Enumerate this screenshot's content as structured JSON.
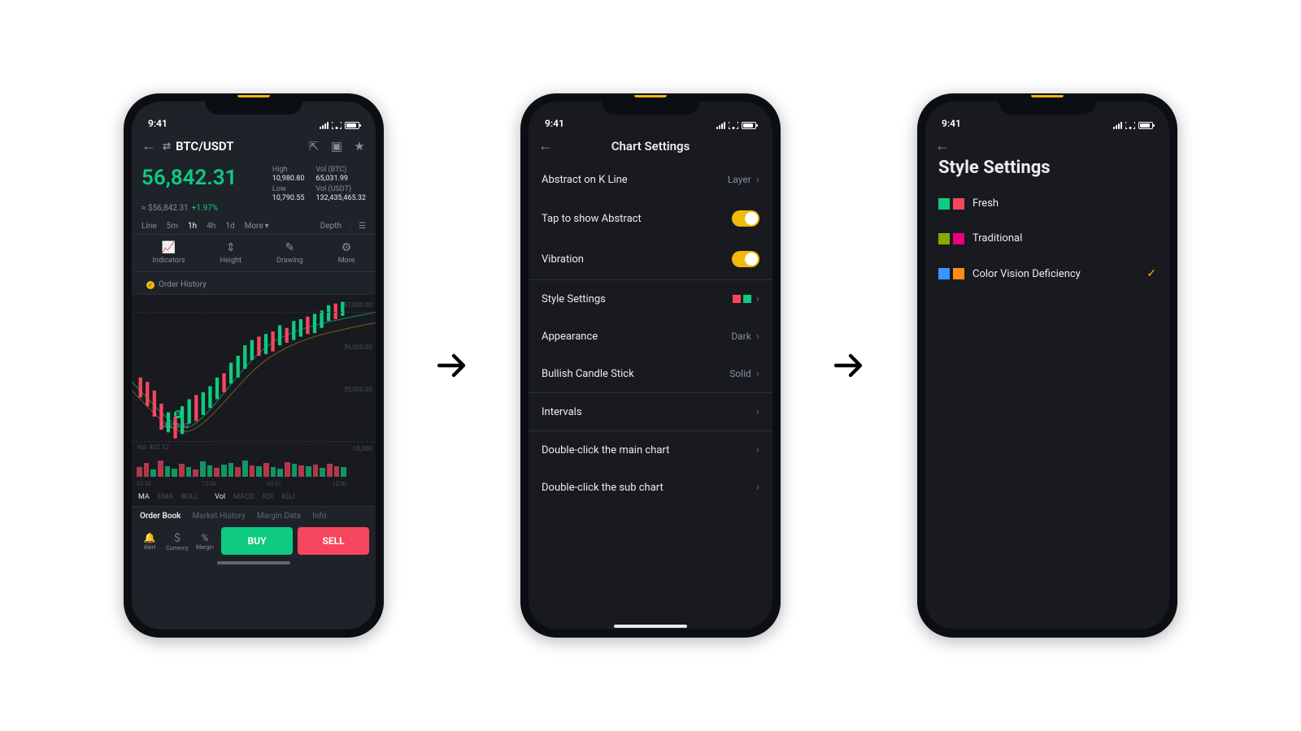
{
  "status_time": "9:41",
  "screen1": {
    "pair": "BTC/USDT",
    "price": "56,842.31",
    "approx": "≈ $56,842.31",
    "change_pct": "+1.97%",
    "stat_high_label": "High",
    "stat_high_val": "10,980.80",
    "stat_low_label": "Low",
    "stat_low_val": "10,790.55",
    "stat_vol_btc_label": "Vol (BTC)",
    "stat_vol_btc_val": "65,031.99",
    "stat_vol_usdt_label": "Vol (USDT)",
    "stat_vol_usdt_val": "132,435,465.32",
    "tf_line": "Line",
    "tf_5m": "5m",
    "tf_1h": "1h",
    "tf_4h": "4h",
    "tf_1d": "1d",
    "tf_more": "More",
    "tf_depth": "Depth",
    "tool_indicators": "Indicators",
    "tool_height": "Height",
    "tool_drawing": "Drawing",
    "tool_more": "More",
    "order_history": "Order History",
    "y1": "57,000.00",
    "y2": "56,000.00",
    "y3": "55,000.00",
    "y4": "10,000",
    "chart_annot": "54,123.32",
    "vol_label": "Vol: 402.12",
    "x_labels": [
      "03-30",
      "12:00",
      "03-31",
      "12:00"
    ],
    "ind_ma": "MA",
    "ind_ema": "EMA",
    "ind_boll": "BOLL",
    "ind_vol": "Vol",
    "ind_macd": "MACD",
    "ind_rsi": "RSI",
    "ind_kdj": "KDJ",
    "tab_orderbook": "Order Book",
    "tab_market": "Market History",
    "tab_margin": "Margin Data",
    "tab_info": "Info",
    "mini_alert": "Alert",
    "mini_currency": "Currency",
    "mini_margin": "Margin",
    "buy": "BUY",
    "sell": "SELL"
  },
  "screen2": {
    "title": "Chart Settings",
    "row_abstract": "Abstract on K Line",
    "row_abstract_val": "Layer",
    "row_tap": "Tap to show Abstract",
    "row_vibration": "Vibration",
    "row_style": "Style Settings",
    "row_appearance": "Appearance",
    "row_appearance_val": "Dark",
    "row_candle": "Bullish Candle Stick",
    "row_candle_val": "Solid",
    "row_intervals": "Intervals",
    "row_dbl_main": "Double-click the main chart",
    "row_dbl_sub": "Double-click the sub chart",
    "style_swatch_red": "#f6465d",
    "style_swatch_green": "#0ecb81"
  },
  "screen3": {
    "title": "Style Settings",
    "opt_fresh": "Fresh",
    "fresh_c1": "#0ecb81",
    "fresh_c2": "#f6465d",
    "opt_trad": "Traditional",
    "trad_c1": "#88aa00",
    "trad_c2": "#e6007a",
    "opt_cvd": "Color Vision Deficiency",
    "cvd_c1": "#3498ff",
    "cvd_c2": "#ff8c1a"
  },
  "chart_data": {
    "type": "area",
    "note": "Candlestick + volume chart; values estimated from axis labels.",
    "candlesticks": {
      "xlabels": [
        "03-30",
        "12:00",
        "03-31",
        "12:00"
      ],
      "ylim": [
        54000,
        57000
      ],
      "ylabels": [
        57000,
        56000,
        55000
      ],
      "annotation_low": 54123.32
    },
    "volume": {
      "label": "Vol",
      "sample_value": 402.12,
      "approx_max": 10000
    }
  }
}
